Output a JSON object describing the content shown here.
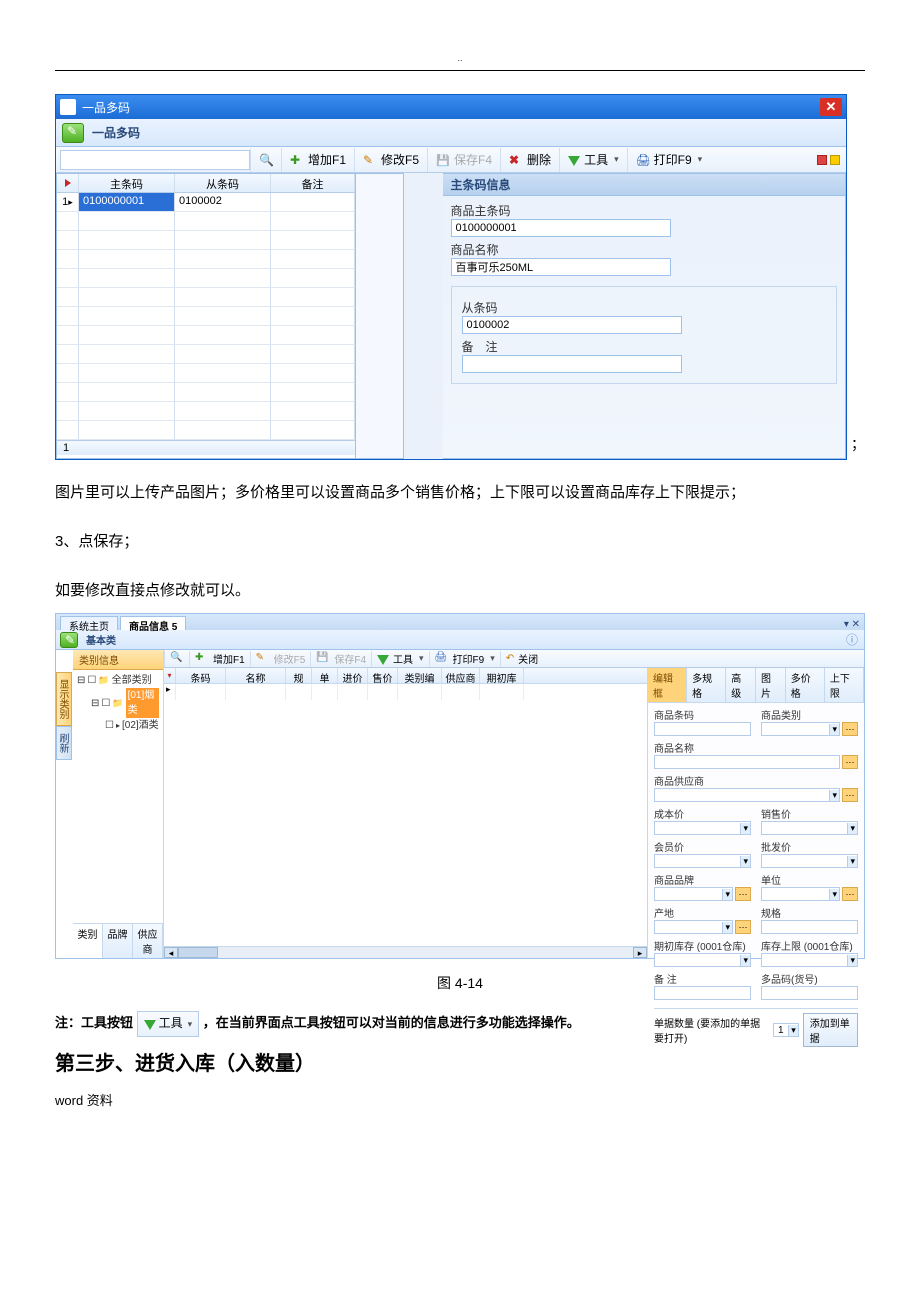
{
  "win1": {
    "title": "一品多码",
    "subtitle": "一品多码",
    "toolbar": {
      "add": "增加F1",
      "edit": "修改F5",
      "save": "保存F4",
      "del": "删除",
      "tool": "工具",
      "print": "打印F9"
    },
    "grid": {
      "cols": {
        "rownum": "",
        "main": "主条码",
        "sub": "从条码",
        "note": "备注"
      },
      "rows": [
        {
          "n": "1",
          "main": "0100000001",
          "sub": "0100002",
          "note": ""
        }
      ],
      "footer": "1"
    },
    "info": {
      "title": "主条码信息",
      "main_label": "商品主条码",
      "main_value": "0100000001",
      "name_label": "商品名称",
      "name_value": "百事可乐250ML",
      "sub_label": "从条码",
      "sub_value": "0100002",
      "note_label": "备　注",
      "note_value": ""
    }
  },
  "text": {
    "semi": "；",
    "para1": "图片里可以上传产品图片；多价格里可以设置商品多个销售价格；上下限可以设置商品库存上下限提示；",
    "para2": "3、点保存；",
    "para3": "如要修改直接点修改就可以。",
    "caption": "图 4-14",
    "note_prefix": "注：工具按钮 ",
    "note_tool": "工具",
    "note_suffix": "，在当前界面点工具按钮可以对当前的信息进行多功能选择操作。",
    "step_heading": "第三步、进货入库（入数量）",
    "footer": "word 资料"
  },
  "win2": {
    "tabs": {
      "t1": "系统主页",
      "t2": "商品信息 5"
    },
    "subtitle": "基本类",
    "toolbar": {
      "add": "增加F1",
      "edit": "修改F5",
      "save": "保存F4",
      "tool": "工具",
      "print": "打印F9",
      "close": "关闭"
    },
    "vtabs": {
      "cat": "显示类别",
      "ref": "刷新"
    },
    "tree": {
      "title": "类别信息",
      "root": "全部类别",
      "n1": "[01]烟类",
      "n2": "[02]酒类"
    },
    "bottom_tabs": {
      "a": "类别",
      "b": "品牌",
      "c": "供应商"
    },
    "grid_cols": {
      "c0": "",
      "c1": "条码",
      "c2": "名称",
      "c3": "规格",
      "c4": "单位",
      "c5": "进价",
      "c6": "售价",
      "c7": "类别编号",
      "c8": "供应商",
      "c9": "期初库存"
    },
    "rtabs": {
      "t1": "编辑框",
      "t2": "多规格",
      "t3": "高级",
      "t4": "图片",
      "t5": "多价格",
      "t6": "上下限"
    },
    "fields": {
      "code": "商品条码",
      "cat": "商品类别",
      "name": "商品名称",
      "supplier": "商品供应商",
      "cost": "成本价",
      "sale": "销售价",
      "vip": "会员价",
      "wholesale": "批发价",
      "brand": "商品品牌",
      "unit": "单位",
      "origin": "产地",
      "spec": "规格",
      "initstock": "期初库存 (0001仓库)",
      "stockmax": "库存上限 (0001仓库)",
      "note": "备 注",
      "multicode": "多品码(货号)"
    },
    "footer": {
      "label": "单据数量 (要添加的单据要打开)",
      "num": "1",
      "btn": "添加到单据"
    }
  }
}
